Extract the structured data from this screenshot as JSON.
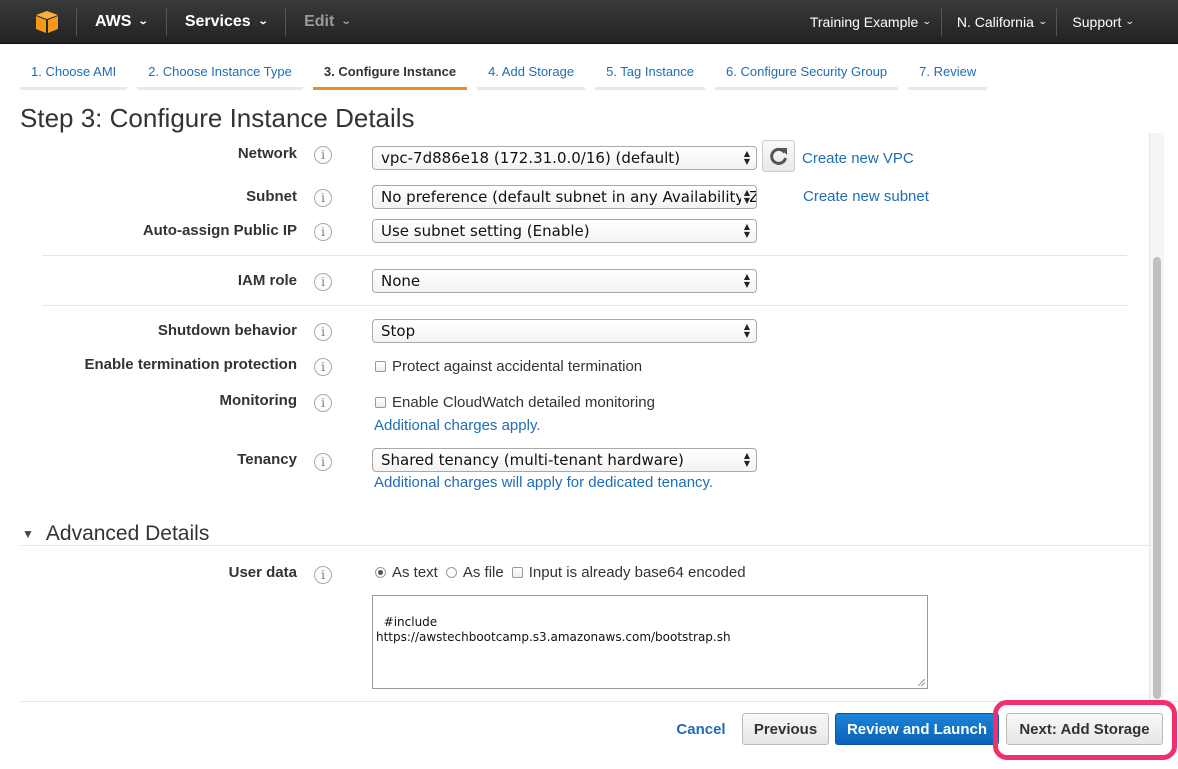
{
  "topnav": {
    "logo": "aws-cube-logo",
    "items": [
      {
        "label": "AWS",
        "icon": "chevron-down-icon"
      },
      {
        "label": "Services",
        "icon": "chevron-down-icon"
      },
      {
        "label": "Edit",
        "icon": "chevron-down-icon",
        "disabled": true
      }
    ],
    "right_items": [
      {
        "label": "Training Example"
      },
      {
        "label": "N. California"
      },
      {
        "label": "Support"
      }
    ],
    "caret_glyph": "⌄"
  },
  "steps": [
    {
      "label": "1. Choose AMI"
    },
    {
      "label": "2. Choose Instance Type"
    },
    {
      "label": "3. Configure Instance",
      "active": true
    },
    {
      "label": "4. Add Storage"
    },
    {
      "label": "5. Tag Instance"
    },
    {
      "label": "6. Configure Security Group"
    },
    {
      "label": "7. Review"
    }
  ],
  "page_title": "Step 3: Configure Instance Details",
  "info_glyph": "i",
  "select_arrows": "▲▼",
  "form": {
    "network": {
      "label": "Network",
      "value": "vpc-7d886e18 (172.31.0.0/16) (default)",
      "link": "Create new VPC"
    },
    "subnet": {
      "label": "Subnet",
      "value": "No preference (default subnet in any Availability Zone)",
      "link": "Create new subnet"
    },
    "public_ip": {
      "label": "Auto-assign Public IP",
      "value": "Use subnet setting (Enable)"
    },
    "iam_role": {
      "label": "IAM role",
      "value": "None"
    },
    "shutdown": {
      "label": "Shutdown behavior",
      "value": "Stop"
    },
    "termination": {
      "label": "Enable termination protection",
      "checkbox_label": "Protect against accidental termination",
      "checked": false
    },
    "monitoring": {
      "label": "Monitoring",
      "checkbox_label": "Enable CloudWatch detailed monitoring",
      "checked": false,
      "note": "Additional charges apply."
    },
    "tenancy": {
      "label": "Tenancy",
      "value": "Shared tenancy (multi-tenant hardware)",
      "note": "Additional charges will apply for dedicated tenancy."
    }
  },
  "advanced": {
    "title": "Advanced Details",
    "toggle_glyph": "▼",
    "user_data": {
      "label": "User data",
      "options": [
        {
          "label": "As text",
          "type": "radio",
          "selected": true
        },
        {
          "label": "As file",
          "type": "radio",
          "selected": false
        },
        {
          "label": "Input is already base64 encoded",
          "type": "checkbox",
          "checked": false
        }
      ],
      "value": "#include\nhttps://awstechbootcamp.s3.amazonaws.com/bootstrap.sh"
    }
  },
  "footer": {
    "cancel": "Cancel",
    "previous": "Previous",
    "review": "Review and Launch",
    "next": "Next: Add Storage",
    "highlight_color": "#f0306a"
  },
  "colors": {
    "link": "#1f6db5",
    "active_tab": "#f08b1c",
    "primary": "#0a62b8",
    "logo": "#f7981d"
  }
}
